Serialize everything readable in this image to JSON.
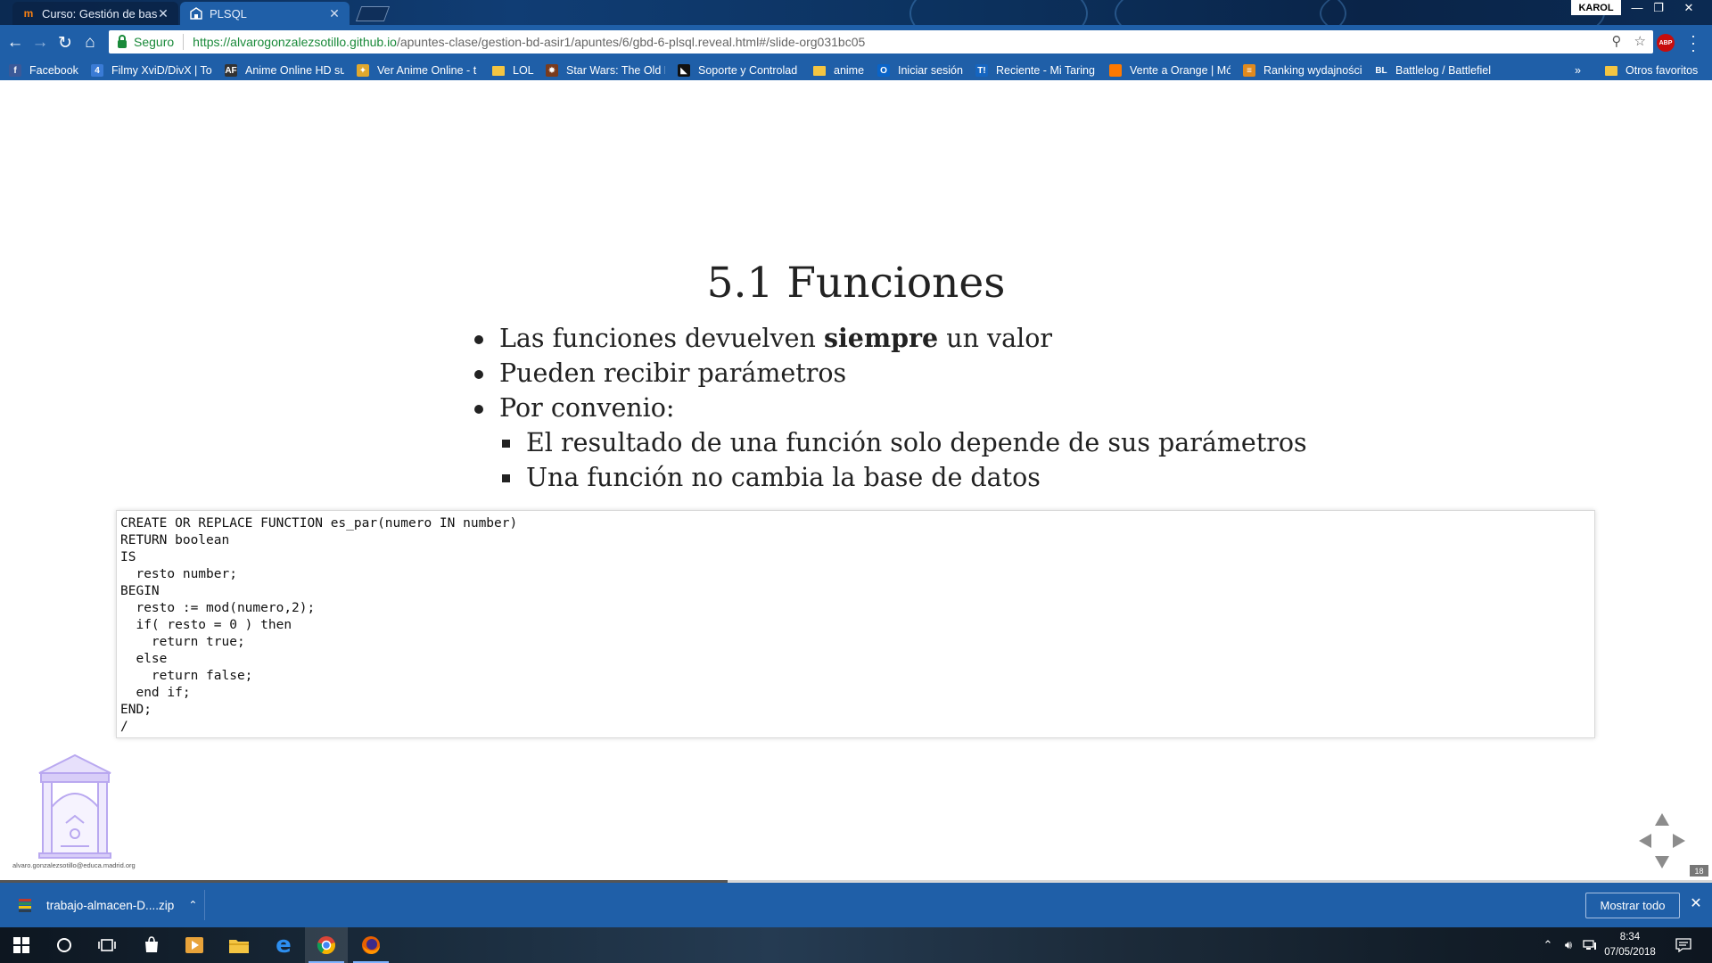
{
  "browser": {
    "tabs": [
      {
        "title": "Curso: Gestión de bases de",
        "icon": "moodle-icon",
        "active": false
      },
      {
        "title": "PLSQL",
        "icon": "page-icon",
        "active": true
      }
    ],
    "user": "KAROL",
    "security_label": "Seguro",
    "url": {
      "scheme_host": "https://alvarogonzalezsotillo.github.io",
      "path": "/apuntes-clase/gestion-bd-asir1/apuntes/6/gbd-6-plsql.reveal.html#/slide-org031bc05"
    },
    "bookmarks": [
      {
        "label": "Facebook",
        "icon": "facebook-icon",
        "color": "#3b5998",
        "glyph": "f"
      },
      {
        "label": "Filmy XviD/DivX | To",
        "icon": "filmy-icon",
        "color": "#3a7bd5",
        "glyph": "4"
      },
      {
        "label": "Anime Online HD su",
        "icon": "anime-af-icon",
        "color": "#333333",
        "glyph": "AF"
      },
      {
        "label": "Ver Anime Online - t",
        "icon": "ver-anime-icon",
        "color": "#e0a82e",
        "glyph": "✦"
      },
      {
        "label": "LOL",
        "icon": "folder-icon",
        "folder": true
      },
      {
        "label": "Star Wars: The Old R",
        "icon": "swtor-icon",
        "color": "#7a3b1d",
        "glyph": "✸"
      },
      {
        "label": "Soporte y Controlad",
        "icon": "amd-icon",
        "color": "#111111",
        "glyph": "◣"
      },
      {
        "label": "anime",
        "icon": "folder-icon",
        "folder": true
      },
      {
        "label": "Iniciar sesión",
        "icon": "outlook-icon",
        "color": "#0a64c8",
        "glyph": "O"
      },
      {
        "label": "Reciente - Mi Taring",
        "icon": "taringa-icon",
        "color": "#1565c0",
        "glyph": "T!"
      },
      {
        "label": "Vente a Orange | Mó",
        "icon": "orange-icon",
        "color": "#ff7900",
        "glyph": ""
      },
      {
        "label": "Ranking wydajności",
        "icon": "ranking-icon",
        "color": "#e08a1e",
        "glyph": "≡"
      },
      {
        "label": "Battlelog / Battlefiel",
        "icon": "battlelog-icon",
        "color": "#1f5fa8",
        "glyph": "BL"
      }
    ],
    "bookmarks_overflow": "»",
    "other_bookmarks": "Otros favoritos"
  },
  "slide": {
    "title": "5.1 Funciones",
    "bullets": {
      "b1_pre": "Las funciones devuelven ",
      "b1_strong": "siempre",
      "b1_post": " un valor",
      "b2": "Pueden recibir parámetros",
      "b3": "Por convenio:",
      "s1": "El resultado de una función solo depende de sus parámetros",
      "s2": "Una función no cambia la base de datos"
    },
    "code": "CREATE OR REPLACE FUNCTION es_par(numero IN number)\nRETURN boolean\nIS\n  resto number;\nBEGIN\n  resto := mod(numero,2);\n  if( resto = 0 ) then\n    return true;\n  else\n    return false;\n  end if;\nEND;\n/",
    "footer_email": "alvaro.gonzalezsotillo@educa.madrid.org",
    "slide_number": "18",
    "progress_fraction": 0.425
  },
  "downloads": {
    "file": "trabajo-almacen-D....zip",
    "show_all": "Mostrar todo"
  },
  "taskbar": {
    "time": "8:34",
    "date": "07/05/2018"
  }
}
